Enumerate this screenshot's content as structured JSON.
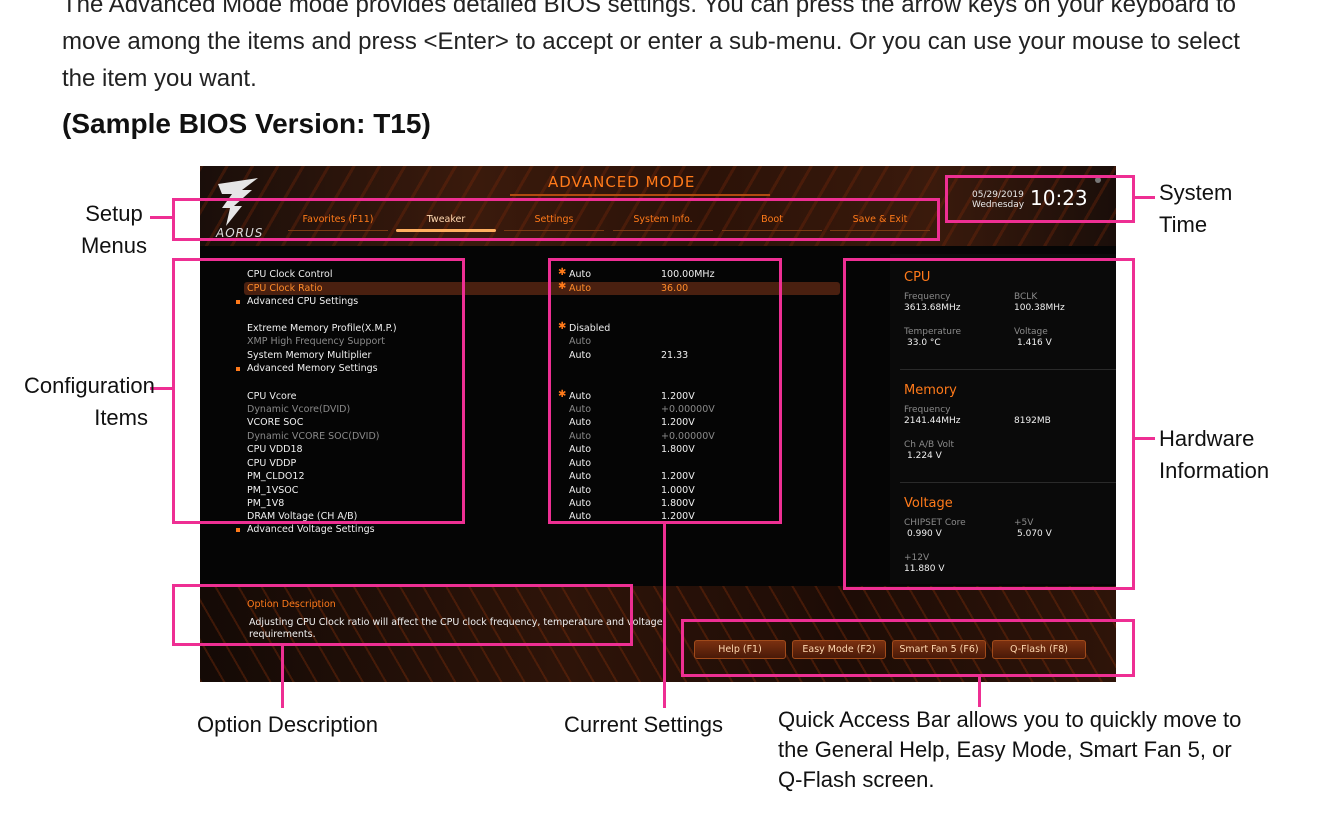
{
  "doc": {
    "intro": "The Advanced Mode mode provides detailed BIOS settings. You can press the arrow keys on your keyboard to move among the items and press <Enter> to accept or enter a sub-menu. Or you can use your mouse to select the item you want.",
    "sample_version": "(Sample BIOS Version: T15)"
  },
  "bios": {
    "title": "ADVANCED MODE",
    "logo_text": "AORUS",
    "date_line1": "05/29/2019",
    "date_line2": "Wednesday",
    "time": "10:23",
    "tabs": [
      "Favorites (F11)",
      "Tweaker",
      "Settings",
      "System Info.",
      "Boot",
      "Save & Exit"
    ],
    "active_tab": "Tweaker",
    "items": [
      {
        "label": "CPU Clock Control",
        "setting": "Auto",
        "value": "100.00MHz",
        "star": true
      },
      {
        "label": "CPU Clock Ratio",
        "setting": "Auto",
        "value": "36.00",
        "star": true,
        "highlight": true
      },
      {
        "label": "Advanced CPU Settings",
        "submenu": true
      },
      {
        "label": "Extreme Memory Profile(X.M.P.)",
        "setting": "Disabled",
        "star": true
      },
      {
        "label": "XMP High Frequency Support",
        "setting": "Auto",
        "dim": true
      },
      {
        "label": "System Memory Multiplier",
        "setting": "Auto",
        "value": "21.33"
      },
      {
        "label": "Advanced Memory Settings",
        "submenu": true
      },
      {
        "label": "CPU Vcore",
        "setting": "Auto",
        "value": "1.200V",
        "star": true
      },
      {
        "label": "Dynamic Vcore(DVID)",
        "setting": "Auto",
        "value": "+0.00000V",
        "dim": true
      },
      {
        "label": "VCORE SOC",
        "setting": "Auto",
        "value": "1.200V"
      },
      {
        "label": "Dynamic VCORE SOC(DVID)",
        "setting": "Auto",
        "value": "+0.00000V",
        "dim": true
      },
      {
        "label": "CPU VDD18",
        "setting": "Auto",
        "value": "1.800V"
      },
      {
        "label": "CPU VDDP",
        "setting": "Auto"
      },
      {
        "label": "PM_CLDO12",
        "setting": "Auto",
        "value": "1.200V"
      },
      {
        "label": "PM_1VSOC",
        "setting": "Auto",
        "value": "1.000V"
      },
      {
        "label": "PM_1V8",
        "setting": "Auto",
        "value": "1.800V"
      },
      {
        "label": "DRAM Voltage    (CH A/B)",
        "setting": "Auto",
        "value": "1.200V"
      },
      {
        "label": "Advanced Voltage Settings",
        "submenu": true
      }
    ],
    "hw": {
      "cpu_head": "CPU",
      "freq_label": "Frequency",
      "freq_value": "3613.68MHz",
      "bclk_label": "BCLK",
      "bclk_value": "100.38MHz",
      "temp_label": "Temperature",
      "temp_value": "33.0 °C",
      "volt_label": "Voltage",
      "volt_value": "1.416 V",
      "mem_head": "Memory",
      "mem_freq_label": "Frequency",
      "mem_freq_value": "2141.44MHz",
      "mem_size_value": "8192MB",
      "chab_label": "Ch A/B Volt",
      "chab_value": "1.224 V",
      "volt_head": "Voltage",
      "chipset_label": "CHIPSET Core",
      "chipset_value": "0.990 V",
      "v5_label": "+5V",
      "v5_value": "5.070 V",
      "v12_label": "+12V",
      "v12_value": "11.880 V"
    },
    "option_desc_title": "Option Description",
    "option_desc_text": "Adjusting CPU Clock ratio will affect the CPU clock frequency, temperature and voltage requirements.",
    "quick_buttons": [
      "Help (F1)",
      "Easy Mode (F2)",
      "Smart Fan 5 (F6)",
      "Q-Flash (F8)"
    ]
  },
  "callouts": {
    "setup_menus": "Setup Menus",
    "system_time": "System Time",
    "configuration_items": "Configuration Items",
    "hardware_information": "Hardware Information",
    "option_description": "Option Description",
    "current_settings": "Current Settings",
    "quick_access": "Quick Access Bar allows you to quickly move to the General Help, Easy Mode, Smart Fan 5, or Q-Flash screen."
  },
  "colors": {
    "accent": "#ff7a1a",
    "annotation": "#ee2f93",
    "bios_bg": "#050505"
  }
}
